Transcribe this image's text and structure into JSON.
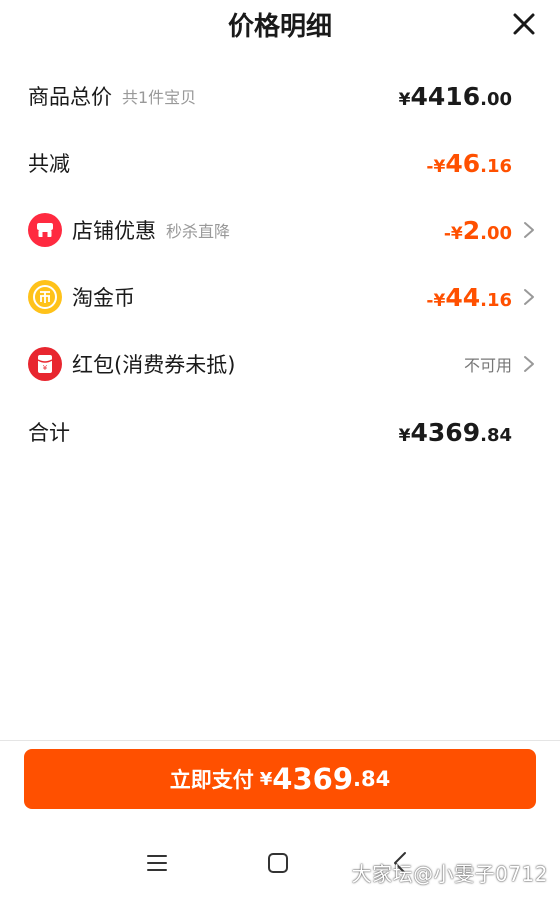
{
  "header": {
    "title": "价格明细"
  },
  "rows": {
    "subtotal": {
      "label": "商品总价",
      "sublabel": "共1件宝贝",
      "symbol": "¥",
      "int": "4416",
      "dec": ".00"
    },
    "reduce": {
      "label": "共减",
      "symbol": "-¥",
      "int": "46",
      "dec": ".16"
    },
    "shop": {
      "label": "店铺优惠",
      "sublabel": "秒杀直降",
      "symbol": "-¥",
      "int": "2",
      "dec": ".00"
    },
    "coins": {
      "label": "淘金币",
      "symbol": "-¥",
      "int": "44",
      "dec": ".16"
    },
    "redpacket": {
      "label": "红包(消费券未抵)",
      "status": "不可用"
    },
    "total": {
      "label": "合计",
      "symbol": "¥",
      "int": "4369",
      "dec": ".84"
    }
  },
  "pay": {
    "label": "立即支付",
    "symbol": "¥",
    "int": "4369",
    "dec": ".84"
  },
  "watermark": "大家坛@小雯子0712",
  "colors": {
    "accent": "#ff5000",
    "shop_icon": "#ff2a40",
    "coin_icon": "#ffc21a",
    "redpacket_icon": "#e8262f"
  },
  "icons": {
    "close": "close-icon",
    "chevron": "chevron-right-icon",
    "shop": "shop-icon",
    "coin": "coin-icon",
    "redpacket": "red-packet-icon",
    "menu": "menu-icon",
    "home": "home-icon",
    "back": "back-icon"
  }
}
